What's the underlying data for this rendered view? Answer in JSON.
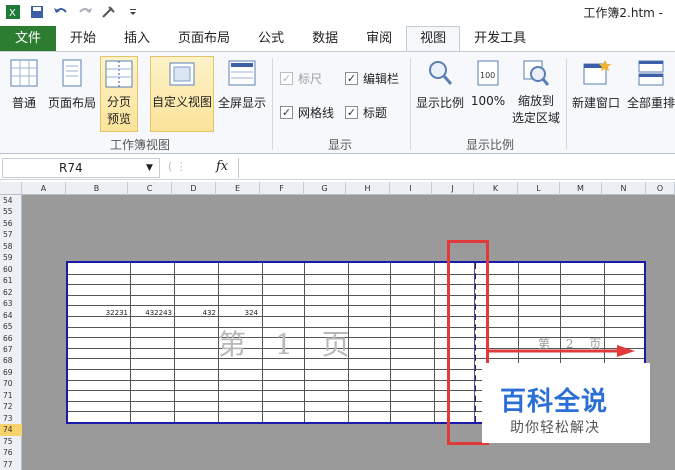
{
  "titlebar": {
    "doc_title": "工作簿2.htm -",
    "quick_access": [
      "excel-logo-icon",
      "save-icon",
      "undo-icon",
      "redo-icon",
      "tools-icon",
      "customize-qat-icon"
    ]
  },
  "tabs": [
    "文件",
    "开始",
    "插入",
    "页面布局",
    "公式",
    "数据",
    "审阅",
    "视图",
    "开发工具"
  ],
  "ribbon": {
    "workbook_views": {
      "label": "工作簿视图",
      "normal": "普通",
      "page_layout": "页面布局",
      "page_break_line1": "分页",
      "page_break_line2": "预览",
      "custom_view": "自定义视图",
      "full_screen": "全屏显示"
    },
    "show": {
      "label": "显示",
      "ruler": "标尺",
      "formula_bar": "编辑栏",
      "gridlines": "网格线",
      "headings": "标题"
    },
    "zoom": {
      "label": "显示比例",
      "zoom": "显示比例",
      "hundred": "100%",
      "selection_line1": "缩放到",
      "selection_line2": "选定区域"
    },
    "window": {
      "new_window": "新建窗口",
      "arrange_all": "全部重排"
    }
  },
  "formula_bar": {
    "name_box": "R74",
    "fx": "fx",
    "value": ""
  },
  "sheet": {
    "columns": [
      "A",
      "B",
      "C",
      "D",
      "E",
      "F",
      "G",
      "H",
      "I",
      "J",
      "K",
      "L",
      "M",
      "N",
      "O"
    ],
    "rows": [
      "54",
      "55",
      "56",
      "57",
      "58",
      "59",
      "60",
      "61",
      "62",
      "63",
      "64",
      "65",
      "66",
      "67",
      "68",
      "69",
      "70",
      "71",
      "72",
      "73",
      "74",
      "75",
      "76",
      "77"
    ],
    "selected_row": "74",
    "cells": {
      "b64": "32231",
      "c64": "432243",
      "d64": "432",
      "e64": "324"
    },
    "page1_watermark": "第 1 页",
    "page2_watermark": "第 2 页"
  },
  "logo": {
    "title": "百科全说",
    "subtitle": "助你轻松解决"
  },
  "colors": {
    "file_tab": "#2c7d32",
    "page_border": "#1a1aa8",
    "annotation": "#e03a3a",
    "logo_blue": "#2b6fd6",
    "selected_row": "#f8d26a"
  }
}
